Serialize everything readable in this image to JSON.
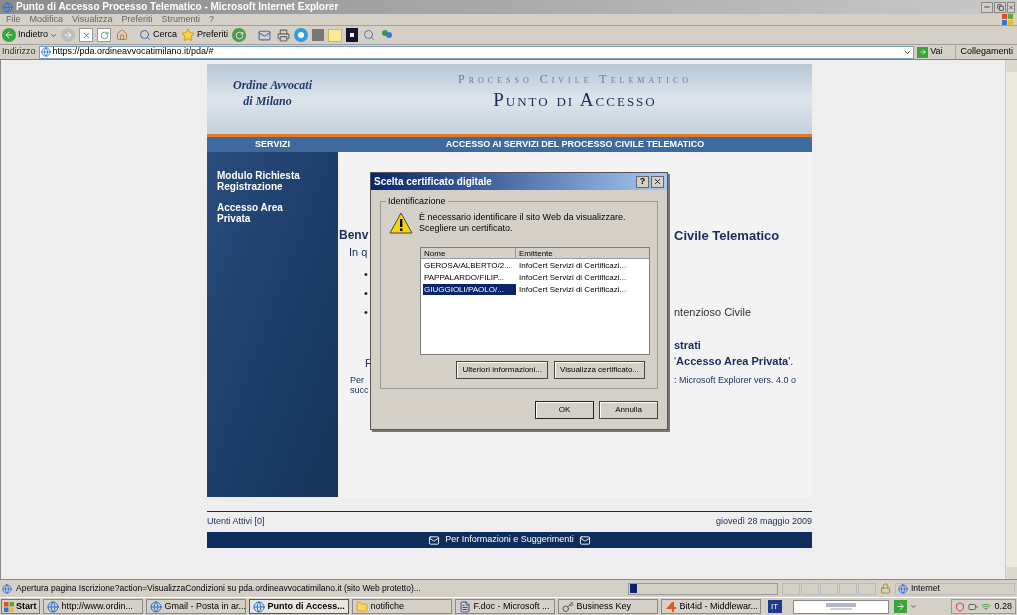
{
  "window": {
    "title": "Punto di Accesso Processo Telematico - Microsoft Internet Explorer"
  },
  "menu": [
    "File",
    "Modifica",
    "Visualizza",
    "Preferiti",
    "Strumenti",
    "?"
  ],
  "toolbar": {
    "back": "Indietro",
    "search": "Cerca",
    "favorites": "Preferiti"
  },
  "address_bar": {
    "label": "Indirizzo",
    "value": "https://pda.ordineavvocatimilano.it/pda/#",
    "go": "Vai",
    "links": "Collegamenti"
  },
  "page": {
    "org": [
      "Ordine Avvocati",
      "di Milano"
    ],
    "subtitle": "Processo Civile Telematico",
    "title": "Punto di Accesso",
    "nav_left": "SERVIZI",
    "nav_right": "ACCESSO AI SERVIZI DEL PROCESSO CIVILE TELEMATICO",
    "sidebar": [
      "Modulo Richiesta Registrazione",
      "Accesso Area Privata"
    ],
    "rows": [
      {
        "kind": "heading",
        "left": "Benv",
        "right": "Civile Telematico"
      },
      {
        "kind": "text",
        "left": "In q"
      },
      {
        "kind": "bullet",
        "left": "•"
      },
      {
        "kind": "bullet",
        "left": "•"
      },
      {
        "kind": "bullet",
        "left": "•",
        "right": "ntenzioso Civile"
      },
      {
        "kind": "bold",
        "right": "strati"
      },
      {
        "kind": "para",
        "left": "F",
        "right": "'**Accesso Area Privata**'."
      },
      {
        "kind": "small",
        "left": "Per",
        "right": ": Microsoft Explorer vers. 4.0 o"
      },
      {
        "kind": "small",
        "left": "succ"
      }
    ],
    "users": "Utenti Attivi [0]",
    "date": "giovedì 28 maggio 2009",
    "footer": "Per Informazioni e Suggerimenti"
  },
  "dialog": {
    "title": "Scelta certificato digitale",
    "help": "?",
    "group": "Identificazione",
    "message": [
      "È necessario identificare il sito Web da visualizzare.",
      "Scegliere un certificato."
    ],
    "columns": [
      "Nome",
      "Emittente"
    ],
    "rows": [
      {
        "name": "GEROSA/ALBERTO/2...",
        "issuer": "InfoCert Servizi di Certificazi...",
        "selected": false
      },
      {
        "name": "PAPPALARDO/FILIP...",
        "issuer": "InfoCert Servizi di Certificazi...",
        "selected": false
      },
      {
        "name": "GIUGGIOLI/PAOLO/...",
        "issuer": "InfoCert Servizi di Certificazi...",
        "selected": true
      }
    ],
    "buttons": [
      "Ulteriori informazioni...",
      "Visualizza certificato..."
    ],
    "ok": "OK",
    "cancel": "Annulla"
  },
  "status_bar": {
    "text": "Apertura pagina Iscrizione?action=VisualizzaCondizioni su pda.ordineavvocatimilano.it (sito Web protetto)...",
    "zone": "Internet",
    "level": 0.05
  },
  "taskbar": {
    "start": "Start",
    "items": [
      {
        "label": "http://www.ordin...",
        "kind": "browser",
        "selected": false
      },
      {
        "label": "Gmail - Posta in ar...",
        "kind": "browser",
        "selected": false
      },
      {
        "label": "Punto di Access...",
        "kind": "browser",
        "selected": true
      },
      {
        "label": "notifiche",
        "kind": "folder",
        "selected": false
      },
      {
        "label": "F.doc - Microsoft ...",
        "kind": "document",
        "selected": false
      },
      {
        "label": "Business Key",
        "kind": "tool",
        "selected": false
      },
      {
        "label": "Bit4id - Middlewar...",
        "kind": "app",
        "selected": false
      }
    ],
    "language": "IT",
    "clock": "0.28"
  }
}
